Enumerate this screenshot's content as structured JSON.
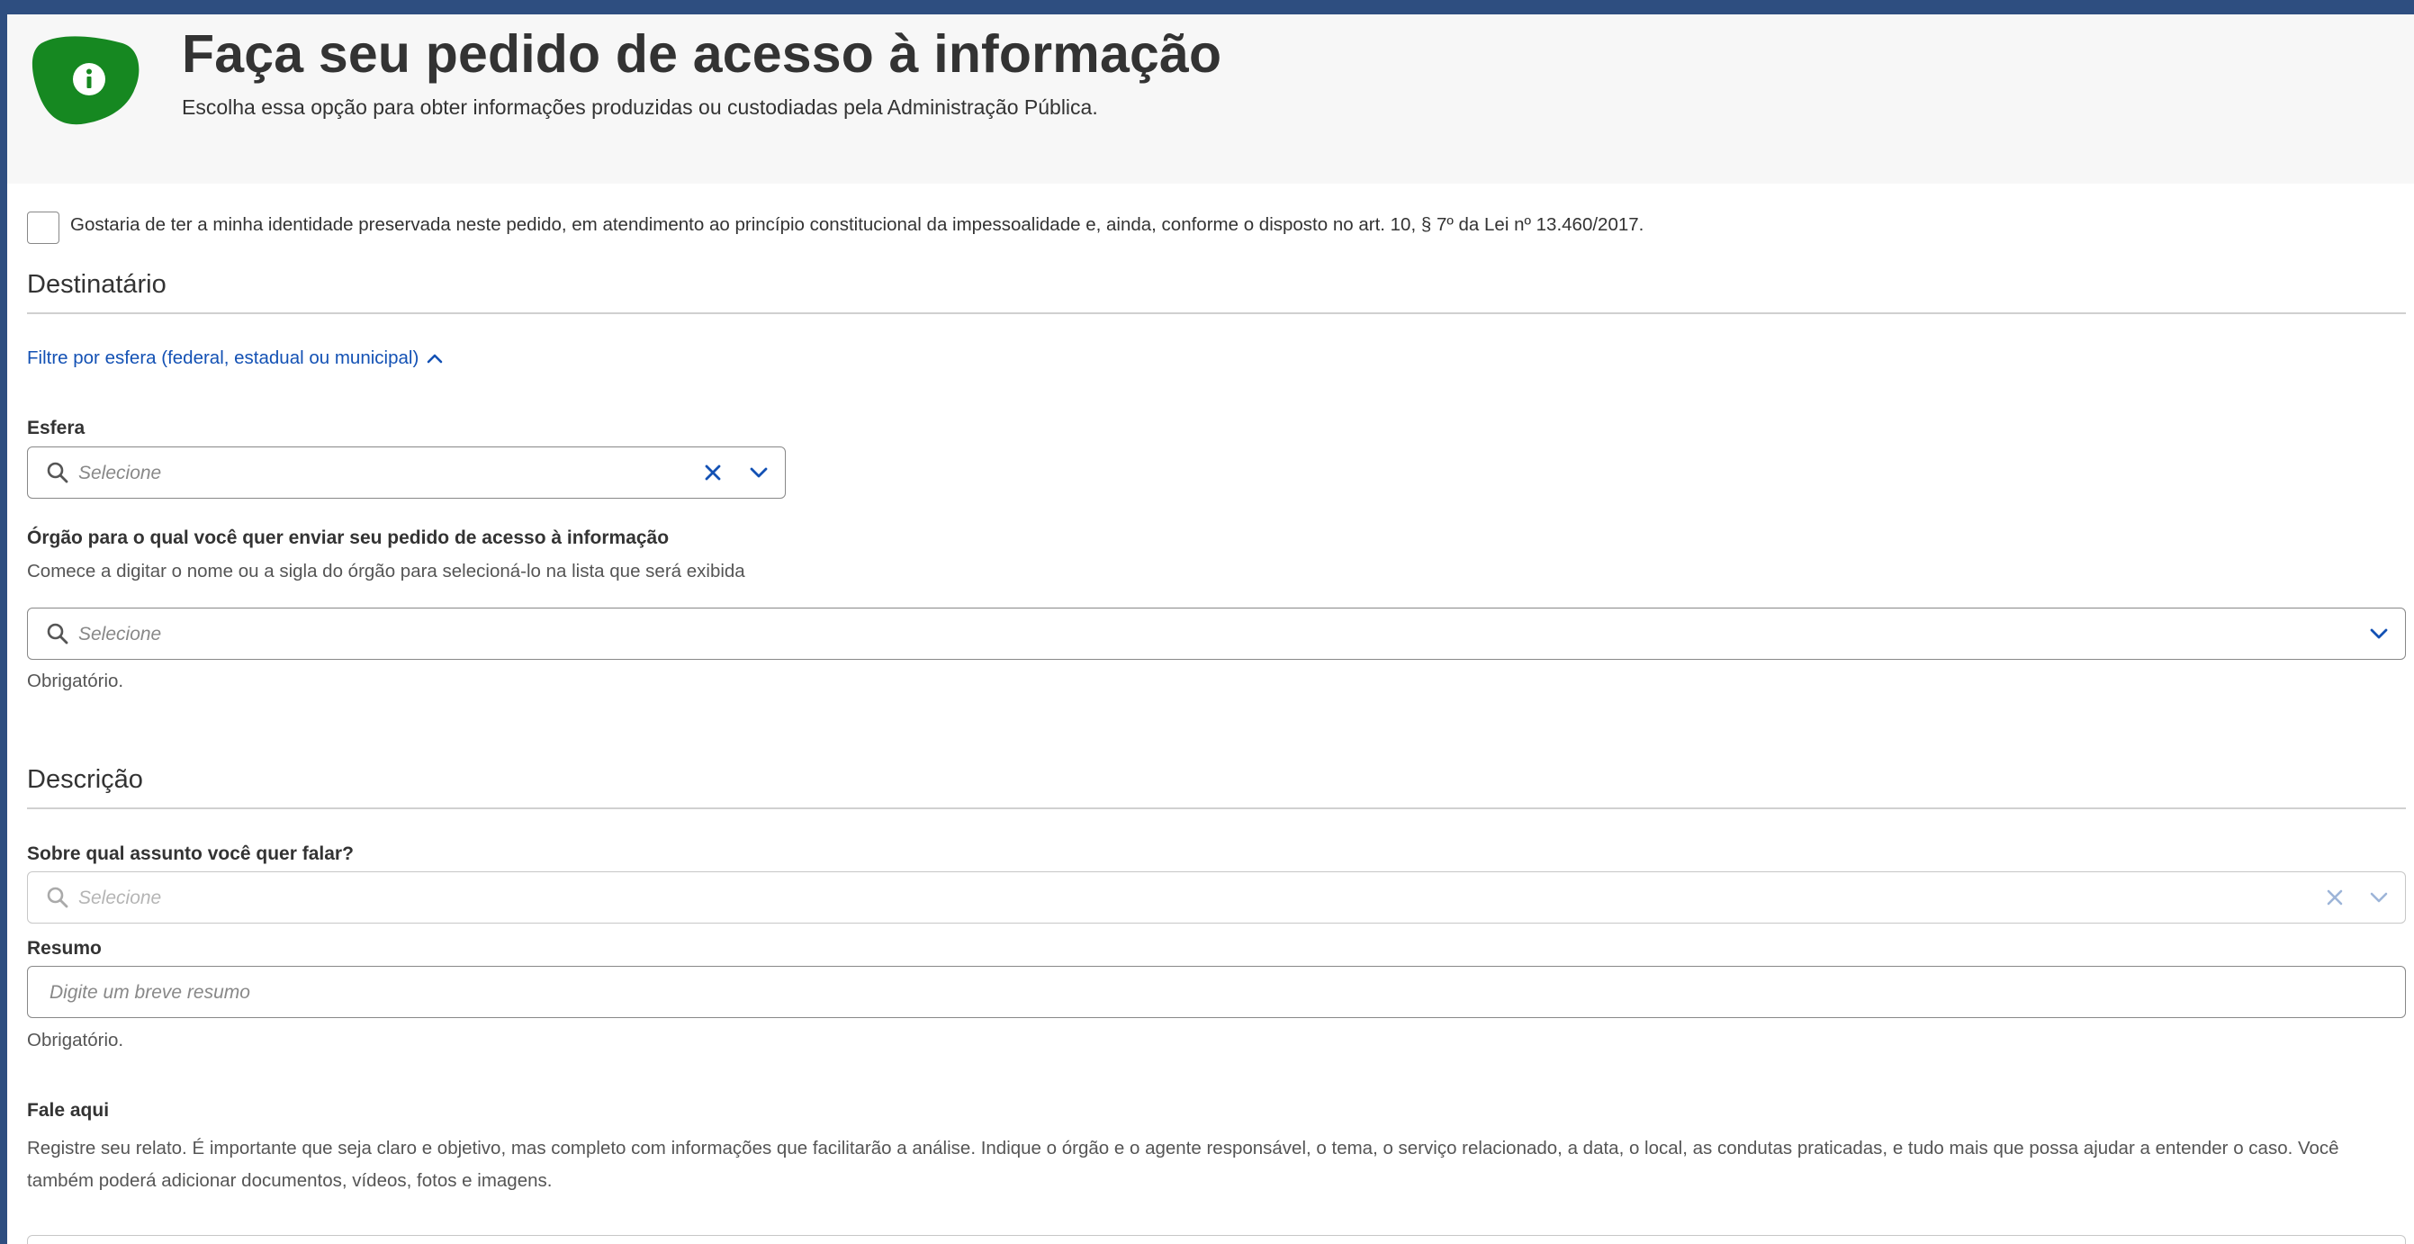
{
  "header": {
    "title": "Faça seu pedido de acesso à informação",
    "subtitle": "Escolha essa opção para obter informações produzidas ou custodiadas pela Administração Pública.",
    "icon": "info-icon",
    "icon_color": "#168821"
  },
  "identity": {
    "checked": false,
    "label": "Gostaria de ter a minha identidade preservada neste pedido, em atendimento ao princípio constitucional da impessoalidade e, ainda, conforme o disposto no art. 10, § 7º da Lei nº 13.460/2017."
  },
  "destinatario": {
    "title": "Destinatário",
    "filter_link": "Filtre por esfera (federal, estadual ou municipal)",
    "esfera": {
      "label": "Esfera",
      "placeholder": "Selecione"
    },
    "orgao": {
      "label": "Órgão para o qual você quer enviar seu pedido de acesso à informação",
      "help": "Comece a digitar o nome ou a sigla do órgão para selecioná-lo na lista que será exibida",
      "placeholder": "Selecione",
      "required": "Obrigatório."
    }
  },
  "descricao": {
    "title": "Descrição",
    "assunto": {
      "label": "Sobre qual assunto você quer falar?",
      "placeholder": "Selecione"
    },
    "resumo": {
      "label": "Resumo",
      "placeholder": "Digite um breve resumo",
      "required": "Obrigatório."
    },
    "fale_aqui": {
      "label": "Fale aqui",
      "help": "Registre seu relato. É importante que seja claro e objetivo, mas completo com informações que facilitarão a análise. Indique o órgão e o agente responsável, o tema, o serviço relacionado, a data, o local, as condutas praticadas, e tudo mais que possa ajudar a entender o caso. Você também poderá adicionar documentos, vídeos, fotos e imagens."
    }
  },
  "colors": {
    "link": "#1351b4",
    "text": "#333333",
    "background_frame": "#2e4e80"
  }
}
